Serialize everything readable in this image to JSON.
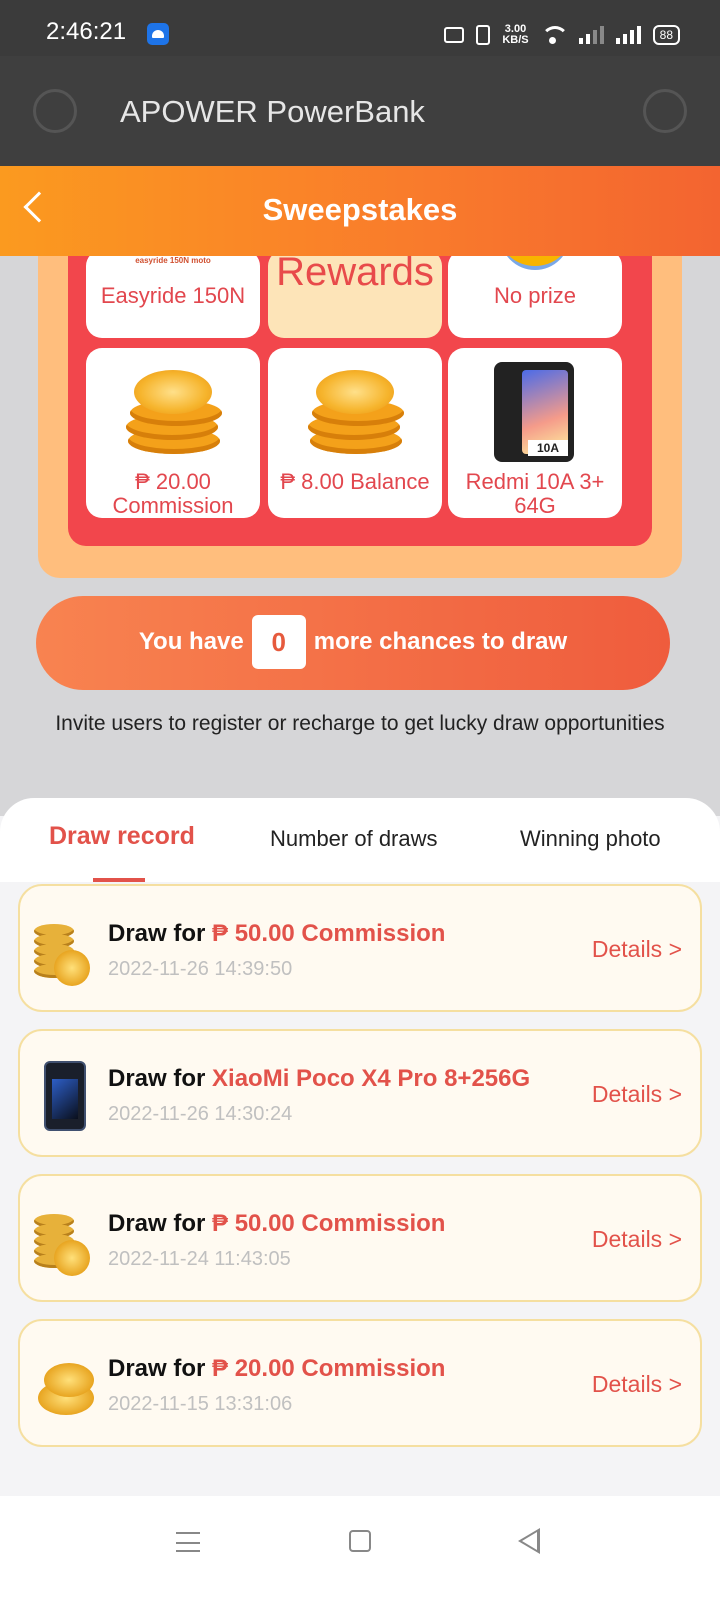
{
  "status": {
    "time": "2:46:21",
    "speed_top": "3.00",
    "speed_bottom": "KB/S",
    "battery": "88"
  },
  "appbar": {
    "title": "APOWER PowerBank"
  },
  "header": {
    "title": "Sweepstakes"
  },
  "prizes": {
    "moto_small": "easyride 150N moto",
    "easyride": "Easyride 150N",
    "center": "Rewards",
    "no_prize": "No prize",
    "commission": "₱ 20.00 Commission",
    "balance": "₱ 8.00 Balance",
    "redmi": "Redmi 10A 3+ 64G",
    "redmi_badge": "10A"
  },
  "draw": {
    "prefix": "You have",
    "count": "0",
    "suffix": "more chances to draw"
  },
  "invite_text": "Invite users to register or recharge to get lucky draw opportunities",
  "tabs": [
    "Draw record",
    "Number of draws",
    "Winning photo"
  ],
  "records": [
    {
      "prefix": "Draw for",
      "prize": "₱ 50.00 Commission",
      "time": "2022-11-26 14:39:50",
      "details": "Details >",
      "icon": "coin-stack-icon"
    },
    {
      "prefix": "Draw for",
      "prize": "XiaoMi Poco X4 Pro 8+256G",
      "time": "2022-11-26 14:30:24",
      "details": "Details >",
      "icon": "phone-icon"
    },
    {
      "prefix": "Draw for",
      "prize": "₱ 50.00 Commission",
      "time": "2022-11-24 11:43:05",
      "details": "Details >",
      "icon": "coin-stack-icon"
    },
    {
      "prefix": "Draw for",
      "prize": "₱ 20.00 Commission",
      "time": "2022-11-15 13:31:06",
      "details": "Details >",
      "icon": "coin-pile-icon"
    }
  ],
  "colors": {
    "accent": "#e2524a",
    "header_start": "#fb9a1f",
    "header_end": "#f36430",
    "grid_red": "#f2464c"
  }
}
